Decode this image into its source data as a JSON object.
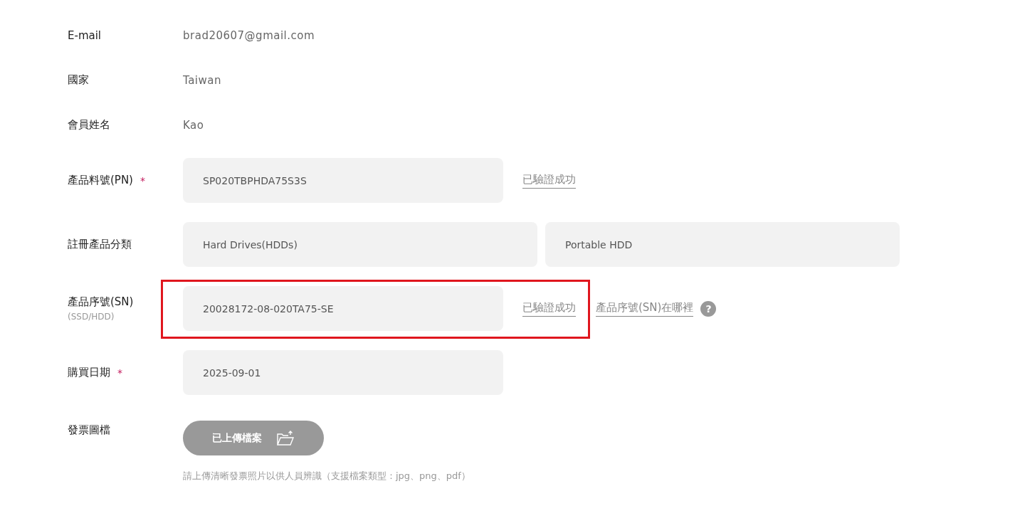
{
  "fields": [
    {
      "kind": "text",
      "label": "E-mail",
      "value": "brad20607@gmail.com"
    },
    {
      "kind": "text",
      "label": "國家",
      "value": "Taiwan"
    },
    {
      "kind": "text",
      "label": "會員姓名",
      "value": "Kao"
    },
    {
      "kind": "input",
      "label": "產品料號(PN)",
      "required": true,
      "value": "SP020TBPHDA75S3S",
      "status": "已驗證成功",
      "highlighted": false
    },
    {
      "kind": "pair",
      "label": "註冊產品分類",
      "values": [
        "Hard Drives(HDDs)",
        "Portable HDD"
      ]
    },
    {
      "kind": "input",
      "label": "產品序號(SN)",
      "sublabel": "(SSD/HDD)",
      "required": false,
      "value": "20028172-08-020TA75-SE",
      "status": "已驗證成功",
      "highlighted": true,
      "help_link": "產品序號(SN)在哪裡"
    },
    {
      "kind": "input",
      "label": "購買日期",
      "required": true,
      "value": "2025-09-01",
      "highlighted": false
    },
    {
      "kind": "upload",
      "label": "發票圖檔",
      "button": "已上傳檔案",
      "hint": "請上傳清晰發票照片以供人員辨識（支援檔案類型：jpg、png、pdf）"
    }
  ],
  "required_mark": "*",
  "help_icon": "?"
}
